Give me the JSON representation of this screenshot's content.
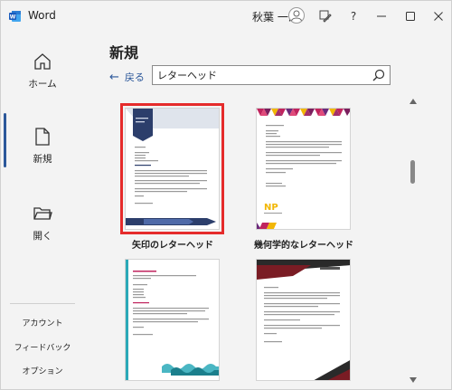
{
  "titlebar": {
    "app_title": "Word",
    "user_name": "秋葉 一郎",
    "help_label": "?",
    "icons": [
      "word-logo-icon",
      "avatar-icon",
      "pen-icon",
      "help-icon",
      "minimize-icon",
      "maximize-icon",
      "close-icon"
    ]
  },
  "sidebar": {
    "items": [
      {
        "label": "ホーム",
        "icon": "home-icon"
      },
      {
        "label": "新規",
        "icon": "new-document-icon"
      },
      {
        "label": "開く",
        "icon": "folder-icon"
      }
    ],
    "bottom_items": [
      {
        "label": "アカウント"
      },
      {
        "label": "フィードバック"
      },
      {
        "label": "オプション"
      }
    ]
  },
  "main": {
    "title": "新規",
    "back_label": "戻る",
    "search": {
      "value": "レターヘッド",
      "placeholder": ""
    },
    "templates": [
      {
        "label": "矢印のレターヘッド",
        "selected": true
      },
      {
        "label": "幾何学的なレターヘッド",
        "selected": false
      },
      {
        "label": "",
        "selected": false
      },
      {
        "label": "",
        "selected": false
      }
    ],
    "np_logo_text": "NP"
  },
  "colors": {
    "accent": "#2b579a",
    "selection": "#e52b2b",
    "arrow_navy": "#2c3e6b",
    "geo_magenta": "#c0245e",
    "geo_yellow": "#f2b705",
    "teal": "#2aa9b8",
    "dark_red": "#7a1c24"
  }
}
